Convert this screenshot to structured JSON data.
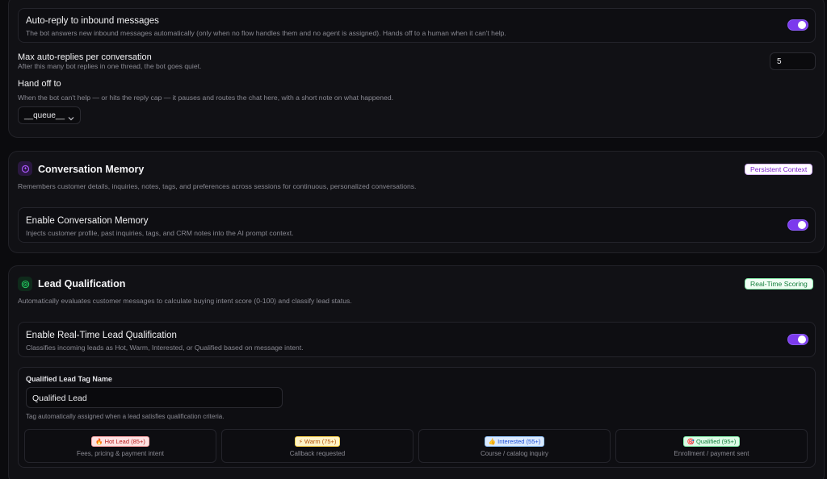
{
  "auto_reply": {
    "title": "Auto-reply to inbound messages",
    "description": "The bot answers new inbound messages automatically (only when no flow handles them and no agent is assigned). Hands off to a human when it can't help.",
    "enabled": true
  },
  "max_replies": {
    "label": "Max auto-replies per conversation",
    "hint": "After this many bot replies in one thread, the bot goes quiet.",
    "value": "5"
  },
  "handoff": {
    "label": "Hand off to",
    "hint": "When the bot can't help — or hits the reply cap — it pauses and routes the chat here, with a short note on what happened.",
    "selected": "__queue__"
  },
  "memory": {
    "title": "Conversation Memory",
    "badge": "Persistent Context",
    "description": "Remembers customer details, inquiries, notes, tags, and preferences across sessions for continuous, personalized conversations.",
    "toggle_title": "Enable Conversation Memory",
    "toggle_desc": "Injects customer profile, past inquiries, tags, and CRM notes into the AI prompt context.",
    "enabled": true,
    "accent": "#a855f7"
  },
  "lead": {
    "title": "Lead Qualification",
    "badge": "Real-Time Scoring",
    "description": "Automatically evaluates customer messages to calculate buying intent score (0-100) and classify lead status.",
    "toggle_title": "Enable Real-Time Lead Qualification",
    "toggle_desc": "Classifies incoming leads as Hot, Warm, Interested, or Qualified based on message intent.",
    "enabled": true,
    "accent": "#22c55e",
    "tag_label": "Qualified Lead Tag Name",
    "tag_value": "Qualified Lead",
    "tag_hint": "Tag automatically assigned when a lead satisfies qualification criteria.",
    "tiers": [
      {
        "label": "🔥 Hot Lead (85+)",
        "desc": "Fees, pricing & payment intent",
        "icon": "fire-icon"
      },
      {
        "label": "⚡ Warm (75+)",
        "desc": "Callback requested",
        "icon": "lightning-icon"
      },
      {
        "label": "👍 Interested (55+)",
        "desc": "Course / catalog inquiry",
        "icon": "thumbs-up-icon"
      },
      {
        "label": "🎯 Qualified (95+)",
        "desc": "Enrollment / payment sent",
        "icon": "target-icon"
      }
    ]
  }
}
